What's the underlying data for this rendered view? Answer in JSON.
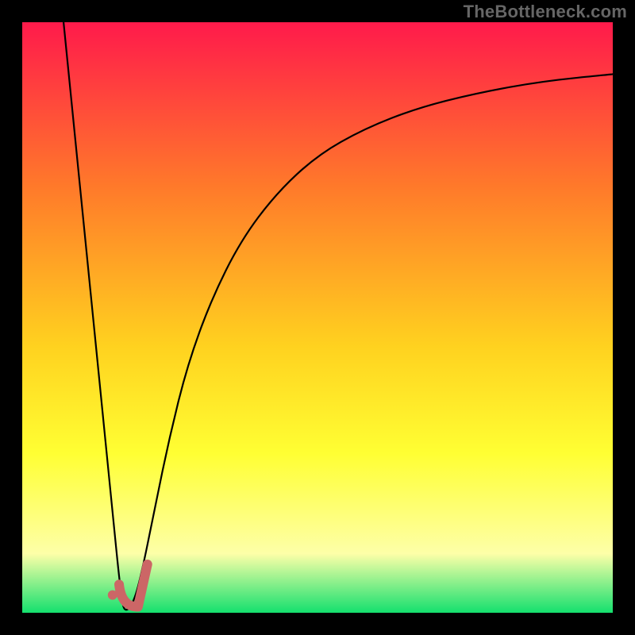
{
  "watermark": {
    "text": "TheBottleneck.com"
  },
  "colors": {
    "gradient_top": "#ff1a4b",
    "gradient_mid1": "#ff7a2a",
    "gradient_mid2": "#ffd21f",
    "gradient_mid3": "#ffff33",
    "gradient_mid4": "#fdffa8",
    "gradient_bottom": "#14e06e",
    "curve": "#000000",
    "marker": "#cc6666",
    "frame": "#000000"
  },
  "chart_data": {
    "type": "line",
    "title": "",
    "xlabel": "",
    "ylabel": "",
    "xlim": [
      0,
      100
    ],
    "ylim": [
      0,
      100
    ],
    "grid": false,
    "legend": false,
    "notes": "Unlabeled bottleneck curve on rainbow gradient background. y represents bottleneck percentage (100 = red/top, 0 = green/bottom). x is an unlabeled parameter axis. Curve drops sharply from top-left to a minimum near x≈17, y≈0, then rises asymptotically toward ~91 at the right edge. A short pink J-shaped marker sits at the trough.",
    "series": [
      {
        "name": "bottleneck-curve",
        "x": [
          7.0,
          9.0,
          11.0,
          13.0,
          15.0,
          16.8,
          17.5,
          19.0,
          20.5,
          22.5,
          25.0,
          28.0,
          32.0,
          37.0,
          43.0,
          50.0,
          58.0,
          67.0,
          77.0,
          88.0,
          100.0
        ],
        "y": [
          100.0,
          80.0,
          60.0,
          40.0,
          20.0,
          2.0,
          0.0,
          2.0,
          8.0,
          18.0,
          30.0,
          42.0,
          53.0,
          63.0,
          71.0,
          77.5,
          82.0,
          85.5,
          88.0,
          90.0,
          91.2
        ]
      }
    ],
    "marker": {
      "name": "trough-marker",
      "color": "#cc6666",
      "stroke_width_px": 12,
      "dot": {
        "x": 15.3,
        "y": 3.0
      },
      "hook_path": [
        {
          "x": 16.4,
          "y": 4.8
        },
        {
          "x": 16.8,
          "y": 1.0
        },
        {
          "x": 19.6,
          "y": 1.0
        },
        {
          "x": 21.2,
          "y": 8.2
        }
      ]
    }
  }
}
